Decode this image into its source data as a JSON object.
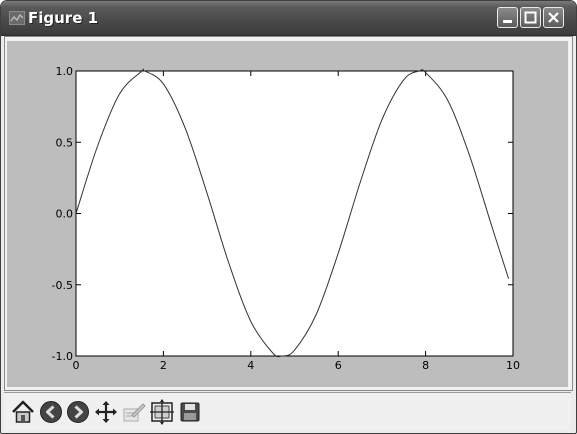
{
  "window": {
    "title": "Figure 1",
    "title_icon": "matplotlib-icon",
    "buttons": [
      "minimize-icon",
      "maximize-icon",
      "close-icon"
    ]
  },
  "colors": {
    "titlebar": "#4b4b4b",
    "figure_background": "#bdbdbd",
    "axes_background": "#ffffff",
    "line": "#333333"
  },
  "toolbar": {
    "tools": [
      "home-icon",
      "back-icon",
      "forward-icon",
      "pan-icon",
      "edit-subplots-icon",
      "zoom-to-rect-icon",
      "save-icon"
    ]
  },
  "chart_data": {
    "type": "line",
    "title": "",
    "xlabel": "",
    "ylabel": "",
    "xlim": [
      0,
      10
    ],
    "ylim": [
      -1.0,
      1.0
    ],
    "x_ticks": [
      "0",
      "2",
      "4",
      "6",
      "8",
      "10"
    ],
    "y_ticks": [
      "1.0",
      "0.5",
      "0.0",
      "-0.5",
      "-1.0"
    ],
    "grid": false,
    "series": [
      {
        "x": [
          0.0,
          0.5,
          1.0,
          1.5,
          1.571,
          2.0,
          2.5,
          3.0,
          3.5,
          4.0,
          4.5,
          4.712,
          5.0,
          5.5,
          6.0,
          6.5,
          7.0,
          7.5,
          7.854,
          8.0,
          8.5,
          9.0,
          9.5,
          9.9
        ],
        "y": [
          0.0,
          0.479,
          0.841,
          0.997,
          1.0,
          0.909,
          0.598,
          0.141,
          -0.351,
          -0.757,
          -0.978,
          -1.0,
          -0.959,
          -0.706,
          -0.279,
          0.215,
          0.657,
          0.938,
          1.0,
          0.989,
          0.798,
          0.412,
          -0.075,
          -0.458
        ]
      }
    ]
  }
}
